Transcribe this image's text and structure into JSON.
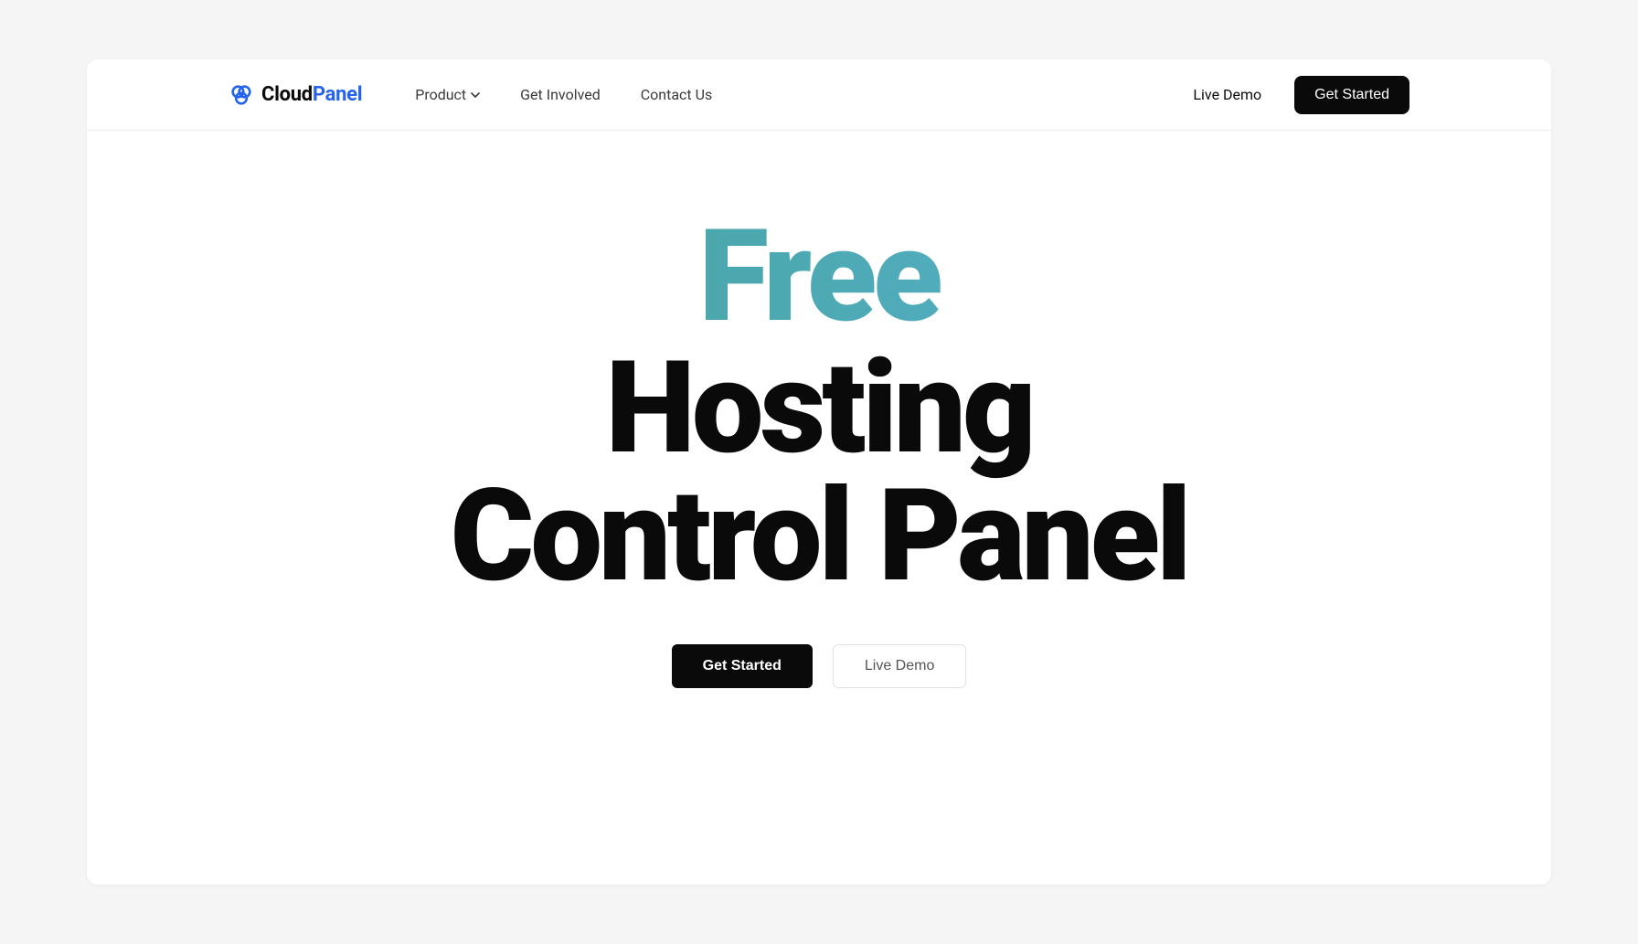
{
  "brand": {
    "name_part1": "Cloud",
    "name_part2": "Panel",
    "accent_color": "#2563eb"
  },
  "nav": {
    "items": [
      {
        "label": "Product",
        "has_dropdown": true
      },
      {
        "label": "Get Involved",
        "has_dropdown": false
      },
      {
        "label": "Contact Us",
        "has_dropdown": false
      }
    ],
    "live_demo": "Live Demo",
    "get_started": "Get Started"
  },
  "hero": {
    "highlight": "Free",
    "rest_line1": "Hosting",
    "rest_line2": "Control Panel",
    "primary_cta": "Get Started",
    "secondary_cta": "Live Demo"
  }
}
